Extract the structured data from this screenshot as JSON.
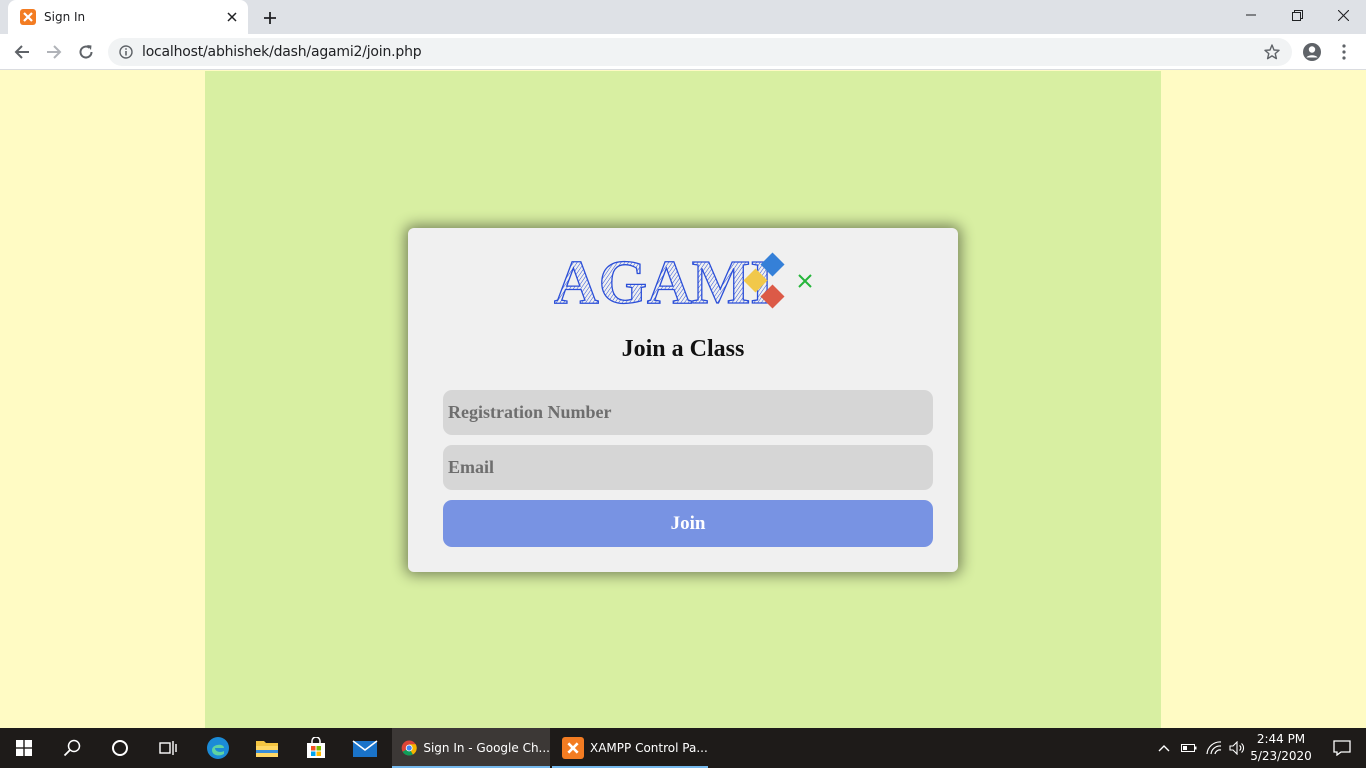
{
  "browser": {
    "tab_title": "Sign In",
    "url": "localhost/abhishek/dash/agami2/join.php"
  },
  "page": {
    "logo_text": "AGAMI",
    "title": "Join a Class",
    "registration_placeholder": "Registration Number",
    "email_placeholder": "Email",
    "join_label": "Join"
  },
  "taskbar": {
    "apps": [
      {
        "label": "Sign In - Google Ch..."
      },
      {
        "label": "XAMPP Control Pa..."
      }
    ],
    "time": "2:44 PM",
    "date": "5/23/2020"
  },
  "colors": {
    "page_bg": "#fffbc4",
    "panel_bg": "#d8efa2",
    "card_bg": "#f0f0f0",
    "button_bg": "#7893e3",
    "logo_blue": "#2b4fd8"
  },
  "icons": [
    "xampp-icon",
    "close-icon",
    "plus-icon",
    "minimize-icon",
    "restore-icon",
    "back-arrow-icon",
    "forward-arrow-icon",
    "reload-icon",
    "info-icon",
    "star-icon",
    "account-icon",
    "kebab-menu-icon",
    "windows-start-icon",
    "search-icon",
    "cortana-icon",
    "task-view-icon",
    "edge-icon",
    "file-explorer-icon",
    "store-icon",
    "mail-icon",
    "chrome-icon",
    "chevron-up-icon",
    "battery-icon",
    "wifi-icon",
    "volume-icon",
    "notification-icon"
  ]
}
